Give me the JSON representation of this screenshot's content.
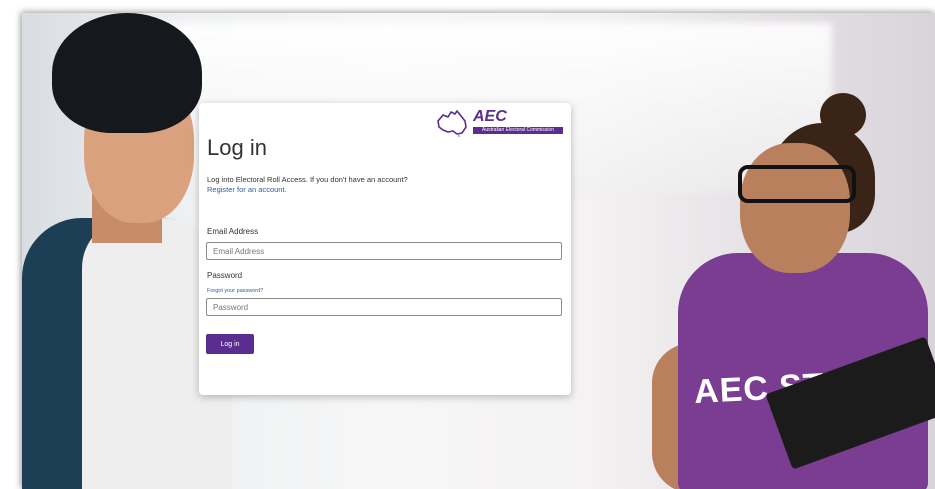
{
  "logo": {
    "name": "AEC",
    "subtitle": "Australian Electoral Commission"
  },
  "login": {
    "title": "Log in",
    "intro": "Log into Electoral Roll Access. If you don't have an account?",
    "register_link": "Register for an account.",
    "email_label": "Email Address",
    "email_placeholder": "Email Address",
    "password_label": "Password",
    "forgot_link": "Forgot your password?",
    "password_placeholder": "Password",
    "submit_label": "Log in"
  },
  "background": {
    "vest_text": "AEC STAFF"
  },
  "colors": {
    "brand_purple": "#5c2d91",
    "link_blue": "#2c5f9e"
  }
}
